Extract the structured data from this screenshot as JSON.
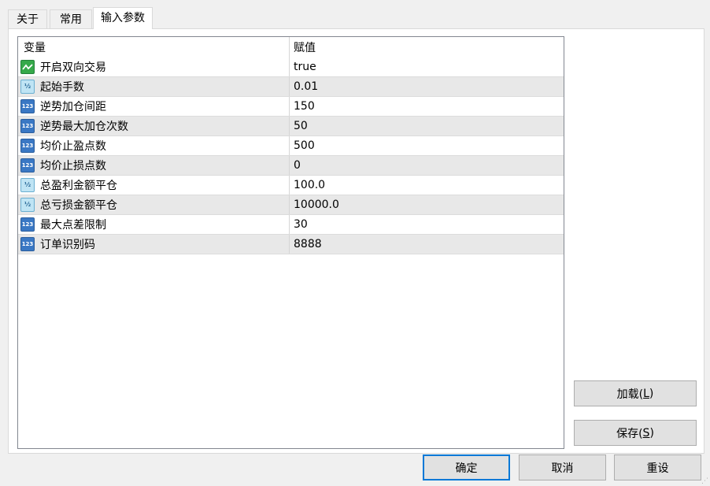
{
  "tabs": [
    {
      "label": "关于"
    },
    {
      "label": "常用"
    },
    {
      "label": "输入参数"
    }
  ],
  "table": {
    "columns": [
      "变量",
      "赋值"
    ],
    "rows": [
      {
        "type": "bool-icon",
        "name": "开启双向交易",
        "value": "true"
      },
      {
        "type": "double-icon",
        "name": "起始手数",
        "value": "0.01"
      },
      {
        "type": "int-icon",
        "name": "逆势加仓间距",
        "value": "150"
      },
      {
        "type": "int-icon",
        "name": "逆势最大加仓次数",
        "value": "50"
      },
      {
        "type": "int-icon",
        "name": "均价止盈点数",
        "value": "500"
      },
      {
        "type": "int-icon",
        "name": "均价止损点数",
        "value": "0"
      },
      {
        "type": "double-icon",
        "name": "总盈利金额平仓",
        "value": "100.0"
      },
      {
        "type": "double-icon",
        "name": "总亏损金额平仓",
        "value": "10000.0"
      },
      {
        "type": "int-icon",
        "name": "最大点差限制",
        "value": "30"
      },
      {
        "type": "int-icon",
        "name": "订单识别码",
        "value": "8888"
      }
    ]
  },
  "side_buttons": {
    "load": {
      "label": "加载(",
      "key": "L",
      "suffix": ")"
    },
    "save": {
      "label": "保存(",
      "key": "S",
      "suffix": ")"
    }
  },
  "footer": {
    "ok": "确定",
    "cancel": "取消",
    "reset": "重设"
  },
  "colors": {
    "accent": "#0078d7",
    "row_alt": "#e8e8e8",
    "int_icon": "#3a78c4",
    "double_icon": "#bfe4f4",
    "bool_icon": "#36a94a"
  }
}
